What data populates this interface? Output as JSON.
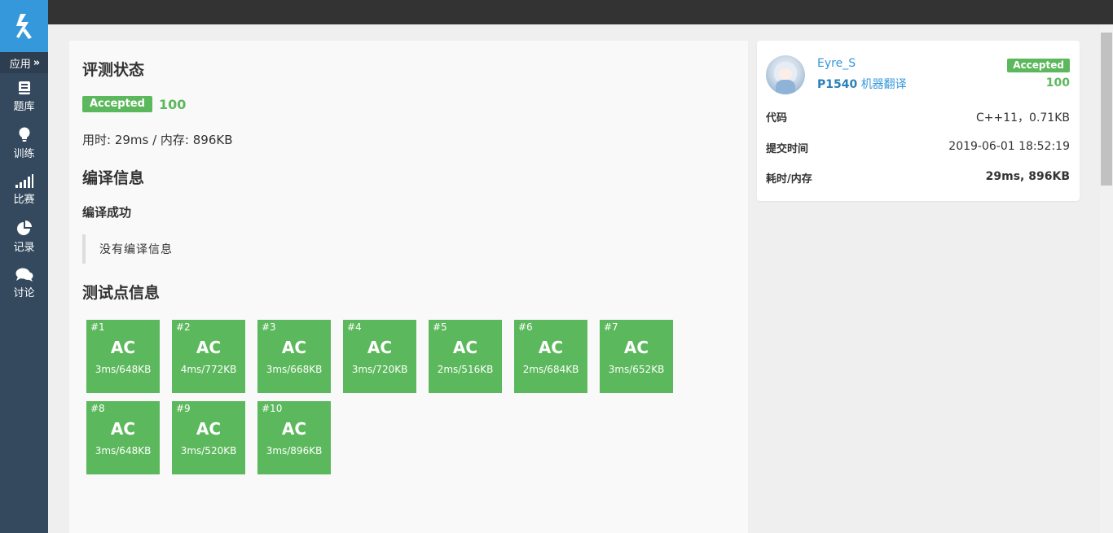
{
  "sidebar": {
    "app_label": "应用",
    "app_chevron": "»",
    "items": [
      {
        "label": "题库",
        "icon": "book-icon"
      },
      {
        "label": "训练",
        "icon": "lightbulb-icon"
      },
      {
        "label": "比赛",
        "icon": "signal-bars-icon"
      },
      {
        "label": "记录",
        "icon": "pie-chart-icon"
      },
      {
        "label": "讨论",
        "icon": "chat-bubbles-icon"
      }
    ]
  },
  "main": {
    "status_title": "评测状态",
    "status_badge": "Accepted",
    "score": "100",
    "time_memory": "用时: 29ms / 内存: 896KB",
    "compile_title": "编译信息",
    "compile_result": "编译成功",
    "compile_message": "没有编译信息",
    "test_title": "测试点信息",
    "testcases": [
      {
        "num": "#1",
        "result": "AC",
        "info": "3ms/648KB"
      },
      {
        "num": "#2",
        "result": "AC",
        "info": "4ms/772KB"
      },
      {
        "num": "#3",
        "result": "AC",
        "info": "3ms/668KB"
      },
      {
        "num": "#4",
        "result": "AC",
        "info": "3ms/720KB"
      },
      {
        "num": "#5",
        "result": "AC",
        "info": "2ms/516KB"
      },
      {
        "num": "#6",
        "result": "AC",
        "info": "2ms/684KB"
      },
      {
        "num": "#7",
        "result": "AC",
        "info": "3ms/652KB"
      },
      {
        "num": "#8",
        "result": "AC",
        "info": "3ms/648KB"
      },
      {
        "num": "#9",
        "result": "AC",
        "info": "3ms/520KB"
      },
      {
        "num": "#10",
        "result": "AC",
        "info": "3ms/896KB"
      }
    ]
  },
  "side": {
    "username": "Eyre_S",
    "problem_id": "P1540",
    "problem_name": "机器翻译",
    "badge": "Accepted",
    "score": "100",
    "code_label": "代码",
    "code_value": "C++11，0.71KB",
    "submit_label": "提交时间",
    "submit_value": "2019-06-01 18:52:19",
    "time_label": "耗时/内存",
    "time_value": "29ms, 896KB"
  },
  "colors": {
    "accepted": "#5cb85c",
    "link": "#3498db",
    "sidebar": "#34495e",
    "logo_bg": "#3498db"
  }
}
